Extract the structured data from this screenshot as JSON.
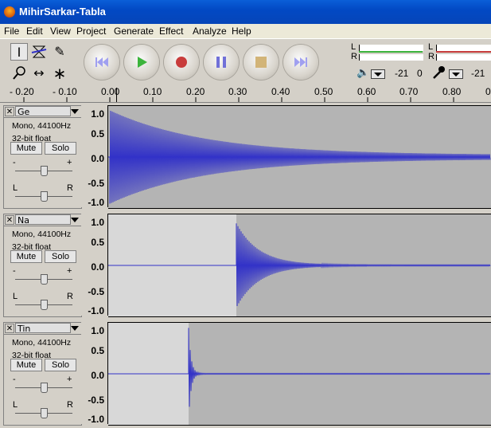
{
  "window": {
    "title": "MihirSarkar-Tabla"
  },
  "menu": [
    "File",
    "Edit",
    "View",
    "Project",
    "Generate",
    "Effect",
    "Analyze",
    "Help"
  ],
  "meters": {
    "play_left": "L",
    "play_right": "R",
    "rec_left": "L",
    "rec_right": "R",
    "play_db": "-21",
    "play_zero": "0",
    "rec_db": "-21"
  },
  "ruler": [
    "- 0.20",
    "- 0.10",
    "0.00",
    "0.10",
    "0.20",
    "0.30",
    "0.40",
    "0.50",
    "0.60",
    "0.70",
    "0.80",
    "0"
  ],
  "tracks": [
    {
      "name": "Ge",
      "info1": "Mono, 44100Hz",
      "info2": "32-bit float",
      "mute": "Mute",
      "solo": "Solo",
      "gain_minus": "-",
      "gain_plus": "+",
      "pan_left": "L",
      "pan_right": "R",
      "scale": [
        "1.0",
        "0.5",
        "0.0",
        "-0.5",
        "-1.0"
      ]
    },
    {
      "name": "Na",
      "info1": "Mono, 44100Hz",
      "info2": "32-bit float",
      "mute": "Mute",
      "solo": "Solo",
      "gain_minus": "-",
      "gain_plus": "+",
      "pan_left": "L",
      "pan_right": "R",
      "scale": [
        "1.0",
        "0.5",
        "0.0",
        "-0.5",
        "-1.0"
      ]
    },
    {
      "name": "Tin",
      "info1": "Mono, 44100Hz",
      "info2": "32-bit float",
      "mute": "Mute",
      "solo": "Solo",
      "gain_minus": "-",
      "gain_plus": "+",
      "pan_left": "L",
      "pan_right": "R",
      "scale": [
        "1.0",
        "0.5",
        "0.0",
        "-0.5",
        "-1.0"
      ]
    }
  ],
  "colors": {
    "titlebar": "#0249c4",
    "waveform": "#3232c8",
    "wave_bg": "#b4b4b4",
    "silence_bg": "#d8d8d8"
  },
  "icons": [
    "selection-tool-icon",
    "envelope-tool-icon",
    "draw-tool-icon",
    "zoom-tool-icon",
    "timeshift-tool-icon",
    "multi-tool-icon",
    "skip-start-icon",
    "play-icon",
    "record-icon",
    "pause-icon",
    "stop-icon",
    "skip-end-icon",
    "speaker-icon",
    "microphone-icon"
  ]
}
